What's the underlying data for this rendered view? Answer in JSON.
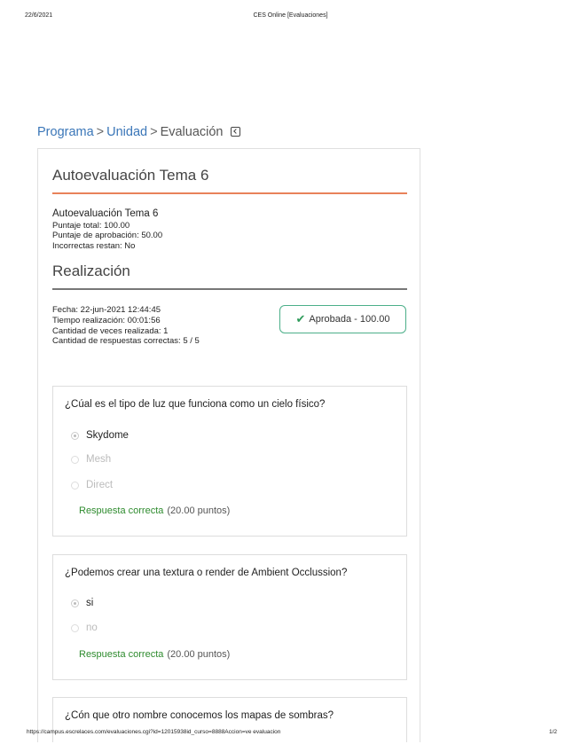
{
  "print_header": {
    "date": "22/6/2021",
    "title": "CES Online [Evaluaciones]"
  },
  "breadcrumb": {
    "program": "Programa",
    "separator": ">",
    "unit": "Unidad",
    "current": "Evaluación"
  },
  "eval": {
    "title": "Autoevaluación Tema 6",
    "name": "Autoevaluación Tema 6",
    "puntaje_total": "Puntaje total: 100.00",
    "puntaje_aprobacion": "Puntaje de aprobación: 50.00",
    "incorrectas": "Incorrectas restan: No"
  },
  "realizacion": {
    "title": "Realización",
    "fecha": "Fecha: 22-jun-2021 12:44:45",
    "tiempo": "Tiempo realización: 00:01:56",
    "cantidad": "Cantidad de veces realizada: 1",
    "correctas": "Cantidad de respuestas correctas: 5 / 5",
    "badge": "Aprobada - 100.00",
    "badge_color": "#4caf89"
  },
  "questions": [
    {
      "text": "¿Cúal es el tipo de luz que funciona como un cielo físico?",
      "options": [
        "Skydome",
        "Mesh",
        "Direct"
      ],
      "result": "Respuesta correcta",
      "points": "(20.00 puntos)"
    },
    {
      "text": "¿Podemos crear una textura o render de Ambient Occlussion?",
      "options": [
        "si",
        "no"
      ],
      "result": "Respuesta correcta",
      "points": "(20.00 puntos)"
    },
    {
      "text": "¿Cón que otro nombre conocemos los mapas de sombras?"
    }
  ],
  "print_footer": {
    "url": "https://campus.escrelaces.com/evaluaciones.cgi?id=12015938id_curso=8888Accion=ve evaluacion",
    "page": "1/2"
  }
}
